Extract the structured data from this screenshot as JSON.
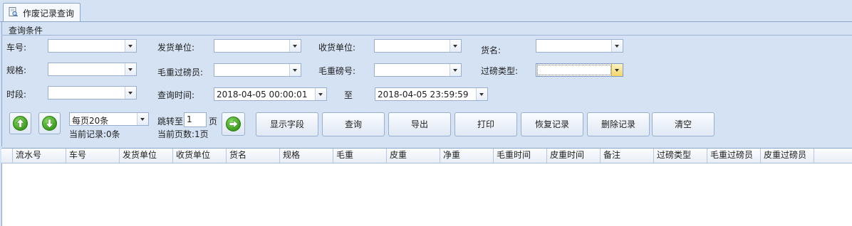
{
  "tab": {
    "label": "作废记录查询",
    "icon": "document-search-icon"
  },
  "panel": {
    "title": "查询条件"
  },
  "filters": {
    "car_no": {
      "label": "车号:",
      "value": ""
    },
    "sender": {
      "label": "发货单位:",
      "value": ""
    },
    "receiver": {
      "label": "收货单位:",
      "value": ""
    },
    "goods": {
      "label": "货名:",
      "value": ""
    },
    "spec": {
      "label": "规格:",
      "value": ""
    },
    "gross_weigher": {
      "label": "毛重过磅员:",
      "value": ""
    },
    "gross_scale": {
      "label": "毛重磅号:",
      "value": ""
    },
    "weigh_type": {
      "label": "过磅类型:",
      "value": ""
    },
    "period": {
      "label": "时段:",
      "value": ""
    },
    "query_time": {
      "label": "查询时间:",
      "start": "2018-04-05 00:00:01",
      "to_label": "至",
      "end": "2018-04-05 23:59:59"
    }
  },
  "pager": {
    "page_size": "每页20条",
    "current_records": "当前记录:0条",
    "jump_label": "跳转至",
    "page_input": "1",
    "page_unit": "页",
    "current_pages": "当前页数:1页"
  },
  "actions": {
    "show_fields": "显示字段",
    "query": "查询",
    "export": "导出",
    "print": "打印",
    "restore": "恢复记录",
    "delete": "删除记录",
    "clear": "清空"
  },
  "columns": [
    "流水号",
    "车号",
    "发货单位",
    "收货单位",
    "货名",
    "规格",
    "毛重",
    "皮重",
    "净重",
    "毛重时间",
    "皮重时间",
    "备注",
    "过磅类型",
    "毛重过磅员",
    "皮重过磅员"
  ],
  "colors": {
    "background": "#d5e2f3",
    "border": "#8aa7cf",
    "nav_green": "#3a9b1c"
  }
}
